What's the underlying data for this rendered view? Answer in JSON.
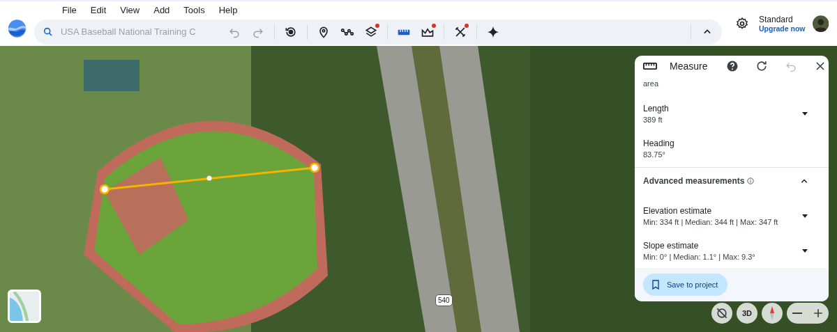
{
  "menu": [
    "File",
    "Edit",
    "View",
    "Add",
    "Tools",
    "Help"
  ],
  "search": {
    "placeholder": "USA Baseball National Training C"
  },
  "history": [
    {
      "kind": "undo",
      "disabled": true
    },
    {
      "kind": "redo",
      "disabled": true
    }
  ],
  "tools": [
    {
      "kind": "history",
      "selected": false,
      "badge": false
    },
    {
      "kind": "pin",
      "selected": false,
      "badge": false
    },
    {
      "kind": "path",
      "selected": false,
      "badge": false
    },
    {
      "kind": "layers",
      "selected": false,
      "badge": true
    },
    {
      "kind": "measure",
      "selected": true,
      "badge": false
    },
    {
      "kind": "elevation",
      "selected": false,
      "badge": true
    },
    {
      "kind": "tools",
      "selected": false,
      "badge": true
    },
    {
      "kind": "sparkle",
      "selected": false,
      "badge": false
    }
  ],
  "account": {
    "plan": "Standard",
    "upgrade": "Upgrade now"
  },
  "map": {
    "route_label": "540"
  },
  "measure_panel": {
    "title": "Measure",
    "undo_disabled": true,
    "partial_text": "area",
    "fields": [
      {
        "label": "Length",
        "value": "389 ft",
        "expandable": true
      },
      {
        "label": "Heading",
        "value": "83.75°",
        "expandable": false
      }
    ],
    "advanced": {
      "title": "Advanced measurements",
      "expanded": true,
      "fields": [
        {
          "label": "Elevation estimate",
          "value": "Min: 334 ft | Median: 344 ft | Max: 347 ft",
          "expandable": true
        },
        {
          "label": "Slope estimate",
          "value": "Min: 0° | Median: 1.1° | Max: 9.3°",
          "expandable": true
        }
      ]
    },
    "save_button": "Save to project"
  },
  "map_controls": {
    "view_mode": "3D"
  }
}
